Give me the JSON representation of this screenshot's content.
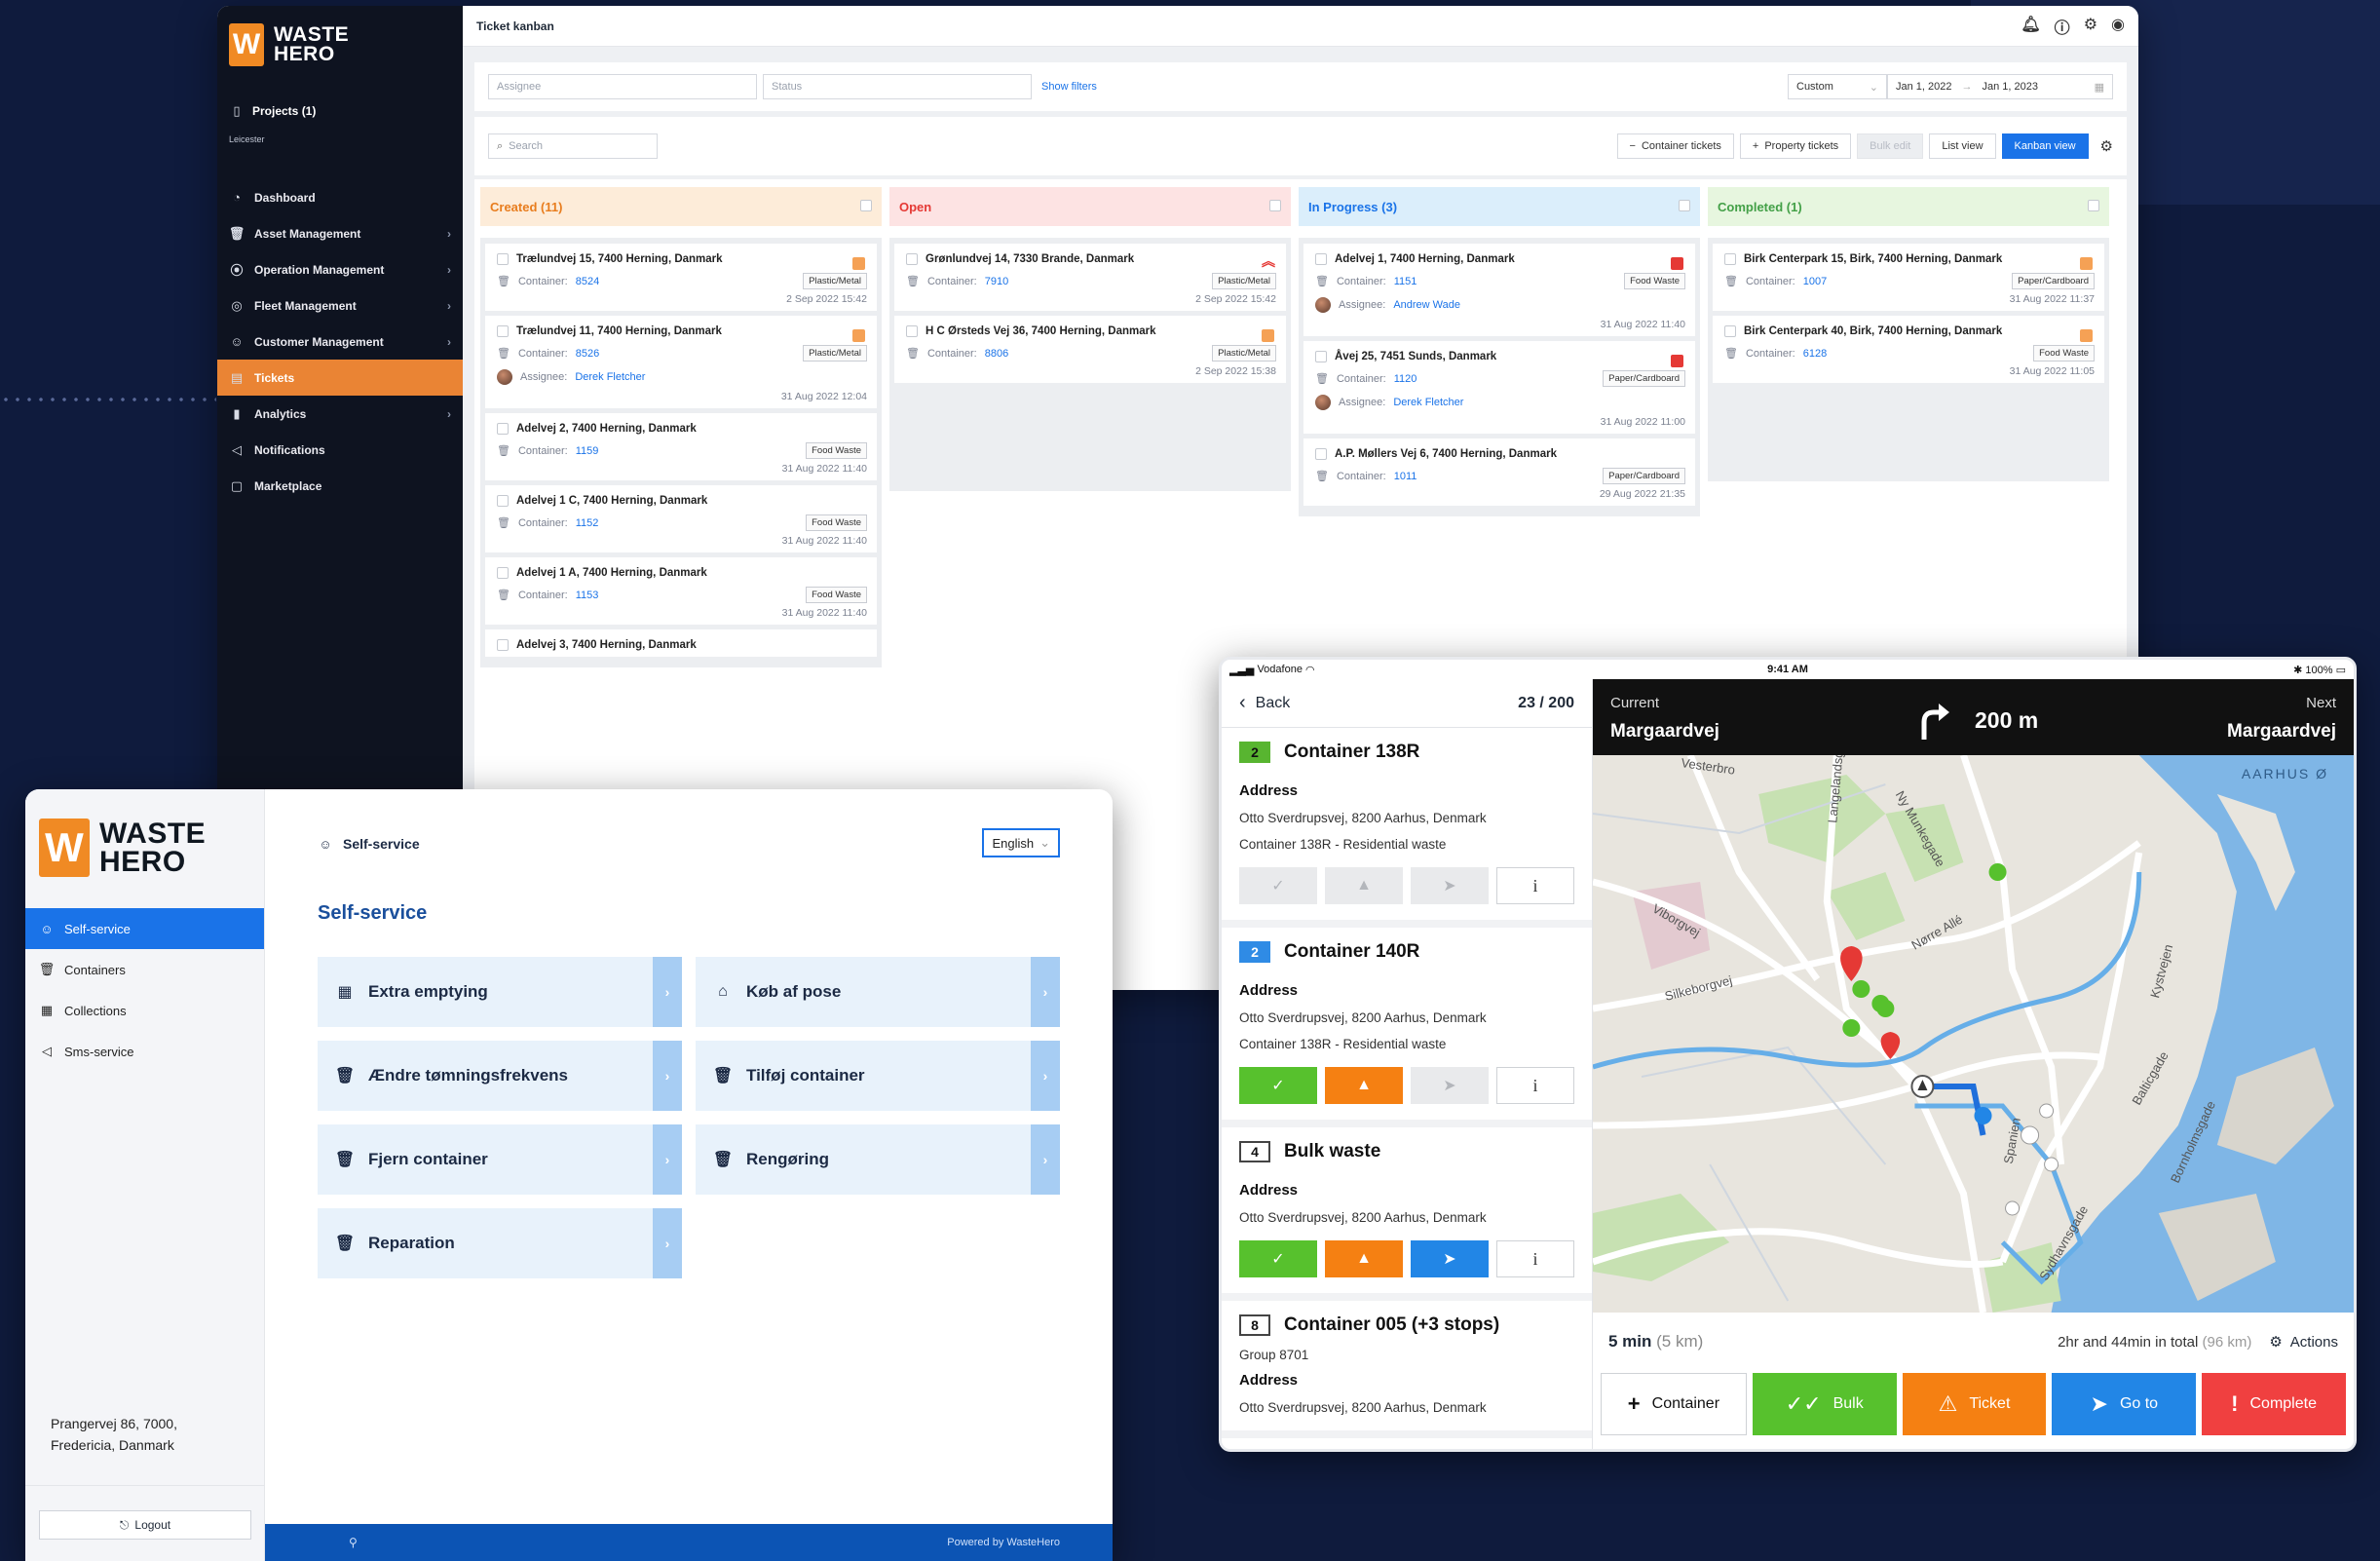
{
  "kanban": {
    "brand": {
      "line1": "WASTE",
      "line2": "HERO",
      "mark": "W"
    },
    "projects": "Projects (1)",
    "project_sub": "Leicester",
    "nav": [
      {
        "label": "Dashboard",
        "icon": "dashboard-icon",
        "chevron": false
      },
      {
        "label": "Asset Management",
        "icon": "bin-icon",
        "chevron": true
      },
      {
        "label": "Operation Management",
        "icon": "operation-icon",
        "chevron": true
      },
      {
        "label": "Fleet Management",
        "icon": "compass-icon",
        "chevron": true
      },
      {
        "label": "Customer Management",
        "icon": "customer-icon",
        "chevron": true
      },
      {
        "label": "Tickets",
        "icon": "ticket-icon",
        "chevron": false,
        "active": true
      },
      {
        "label": "Analytics",
        "icon": "chart-icon",
        "chevron": true
      },
      {
        "label": "Notifications",
        "icon": "megaphone-icon",
        "chevron": false
      },
      {
        "label": "Marketplace",
        "icon": "bag-icon",
        "chevron": false
      }
    ],
    "page_title": "Ticket kanban",
    "filters": {
      "assignee_placeholder": "Assignee",
      "status_placeholder": "Status",
      "show_filters": "Show filters",
      "range": "Custom",
      "date_from": "Jan 1, 2022",
      "date_sep": "→",
      "date_to": "Jan 1, 2023"
    },
    "search_placeholder": "Search",
    "toolbar": {
      "container_tickets": "Container tickets",
      "property_tickets": "Property tickets",
      "bulk_edit": "Bulk edit",
      "list_view": "List view",
      "kanban_view": "Kanban view"
    },
    "container_prefix": "Container:",
    "assignee_prefix": "Assignee:",
    "columns": [
      {
        "title": "Created (11)",
        "color": "#fdecd9",
        "text": "#e87d1e",
        "cards": [
          {
            "address": "Trælundvej 15, 7400 Herning, Danmark",
            "container": "8524",
            "tag": "Plastic/Metal",
            "date": "2 Sep 2022 15:42",
            "prio": "orange"
          },
          {
            "address": "Trælundvej 11, 7400 Herning, Danmark",
            "container": "8526",
            "tag": "Plastic/Metal",
            "assignee": "Derek Fletcher",
            "date": "31 Aug 2022 12:04",
            "prio": "orange"
          },
          {
            "address": "Adelvej 2, 7400 Herning, Danmark",
            "container": "1159",
            "tag": "Food Waste",
            "date": "31 Aug 2022 11:40"
          },
          {
            "address": "Adelvej 1 C, 7400 Herning, Danmark",
            "container": "1152",
            "tag": "Food Waste",
            "date": "31 Aug 2022 11:40"
          },
          {
            "address": "Adelvej 1 A, 7400 Herning, Danmark",
            "container": "1153",
            "tag": "Food Waste",
            "date": "31 Aug 2022 11:40"
          },
          {
            "address": "Adelvej 3, 7400 Herning, Danmark"
          }
        ]
      },
      {
        "title": "Open",
        "color": "#fde3e3",
        "text": "#e53935",
        "cards": [
          {
            "address": "Grønlundvej 14, 7330 Brande, Danmark",
            "container": "7910",
            "tag": "Plastic/Metal",
            "date": "2 Sep 2022 15:42",
            "prio": "up"
          },
          {
            "address": "H C Ørsteds Vej 36, 7400 Herning, Danmark",
            "container": "8806",
            "tag": "Plastic/Metal",
            "date": "2 Sep 2022 15:38",
            "prio": "orange"
          }
        ]
      },
      {
        "title": "In Progress (3)",
        "color": "#dbeefb",
        "text": "#1a73e8",
        "cards": [
          {
            "address": "Adelvej 1, 7400 Herning, Danmark",
            "container": "1151",
            "tag": "Food Waste",
            "assignee": "Andrew Wade",
            "date": "31 Aug 2022 11:40",
            "prio": "red"
          },
          {
            "address": "Åvej 25, 7451 Sunds, Danmark",
            "container": "1120",
            "tag": "Paper/Cardboard",
            "assignee": "Derek Fletcher",
            "date": "31 Aug 2022 11:00",
            "prio": "red"
          },
          {
            "address": "A.P. Møllers Vej 6, 7400 Herning, Danmark",
            "container": "1011",
            "tag": "Paper/Cardboard",
            "date": "29 Aug 2022 21:35"
          }
        ]
      },
      {
        "title": "Completed (1)",
        "color": "#e7f6df",
        "text": "#43a047",
        "cards": [
          {
            "address": "Birk Centerpark 15, Birk, 7400 Herning, Danmark",
            "container": "1007",
            "tag": "Paper/Cardboard",
            "date": "31 Aug 2022 11:37",
            "prio": "orange"
          },
          {
            "address": "Birk Centerpark 40, Birk, 7400 Herning, Danmark",
            "container": "6128",
            "tag": "Food Waste",
            "date": "31 Aug 2022 11:05",
            "prio": "orange"
          }
        ]
      }
    ]
  },
  "selfservice": {
    "brand": {
      "line1": "WASTE",
      "line2": "HERO",
      "mark": "W"
    },
    "nav": [
      {
        "label": "Self-service",
        "icon": "smile-icon",
        "active": true
      },
      {
        "label": "Containers",
        "icon": "bin-icon"
      },
      {
        "label": "Collections",
        "icon": "calendar-icon"
      },
      {
        "label": "Sms-service",
        "icon": "megaphone-icon"
      }
    ],
    "address_line1": "Prangervej 86, 7000,",
    "address_line2": "Fredericia, Danmark",
    "logout": "Logout",
    "header": "Self-service",
    "language": "English",
    "title": "Self-service",
    "tiles": [
      {
        "label": "Extra emptying",
        "icon": "calendar-icon"
      },
      {
        "label": "Køb af pose",
        "icon": "home-icon"
      },
      {
        "label": "Ændre tømningsfrekvens",
        "icon": "bin-icon"
      },
      {
        "label": "Tilføj container",
        "icon": "bin-icon"
      },
      {
        "label": "Fjern container",
        "icon": "bin-icon"
      },
      {
        "label": "Rengøring",
        "icon": "bin-icon"
      },
      {
        "label": "Reparation",
        "icon": "bin-icon"
      }
    ],
    "powered": "Powered by WasteHero"
  },
  "navapp": {
    "status": {
      "carrier": "Vodafone",
      "time": "9:41 AM",
      "battery": "100%"
    },
    "back": "Back",
    "count": "23 / 200",
    "address_label": "Address",
    "stops": [
      {
        "badge": "2",
        "badge_style": "green",
        "title": "Container 138R",
        "address": "Otto Sverdrupsvej, 8200 Aarhus, Denmark",
        "detail": "Container 138R - Residential waste",
        "actions": "grey"
      },
      {
        "badge": "2",
        "badge_style": "blue",
        "title": "Container 140R",
        "address": "Otto Sverdrupsvej, 8200 Aarhus, Denmark",
        "detail": "Container 138R - Residential waste",
        "actions": "partial"
      },
      {
        "badge": "4",
        "badge_style": "outline",
        "title": "Bulk waste",
        "address": "Otto Sverdrupsvej, 8200 Aarhus, Denmark",
        "actions": "full"
      },
      {
        "badge": "8",
        "badge_style": "outline",
        "title": "Container 005 (+3 stops)",
        "group": "Group 8701",
        "address": "Otto Sverdrupsvej, 8200 Aarhus, Denmark"
      }
    ],
    "info_icon": "i",
    "current_label": "Current",
    "current_street": "Margaardvej",
    "distance": "200 m",
    "next_label": "Next",
    "next_street": "Margaardvej",
    "map_labels": [
      "Viborgvej",
      "Silkeborgvej",
      "Nørre Allé",
      "Langelandsgade",
      "Ny Munkegade",
      "Kystvejen",
      "AARHUS Ø",
      "Spanien",
      "Sydhavnsgade",
      "Bornholmsgade",
      "Balticgade",
      "Vesterbro"
    ],
    "eta": "5 min",
    "eta_km": "(5 km)",
    "total": "2hr and 44min in total",
    "total_km": "(96 km)",
    "actions": "Actions",
    "buttons": [
      {
        "label": "Container",
        "style": "white",
        "icon": "+"
      },
      {
        "label": "Bulk",
        "style": "green",
        "icon": "✓✓"
      },
      {
        "label": "Ticket",
        "style": "orange",
        "icon": "⚠"
      },
      {
        "label": "Go to",
        "style": "blue",
        "icon": "➤"
      },
      {
        "label": "Complete",
        "style": "red",
        "icon": "!"
      }
    ],
    "colors": {
      "green": "#57c12d",
      "orange": "#f58012",
      "blue": "#2286e6",
      "red": "#f04040"
    }
  }
}
